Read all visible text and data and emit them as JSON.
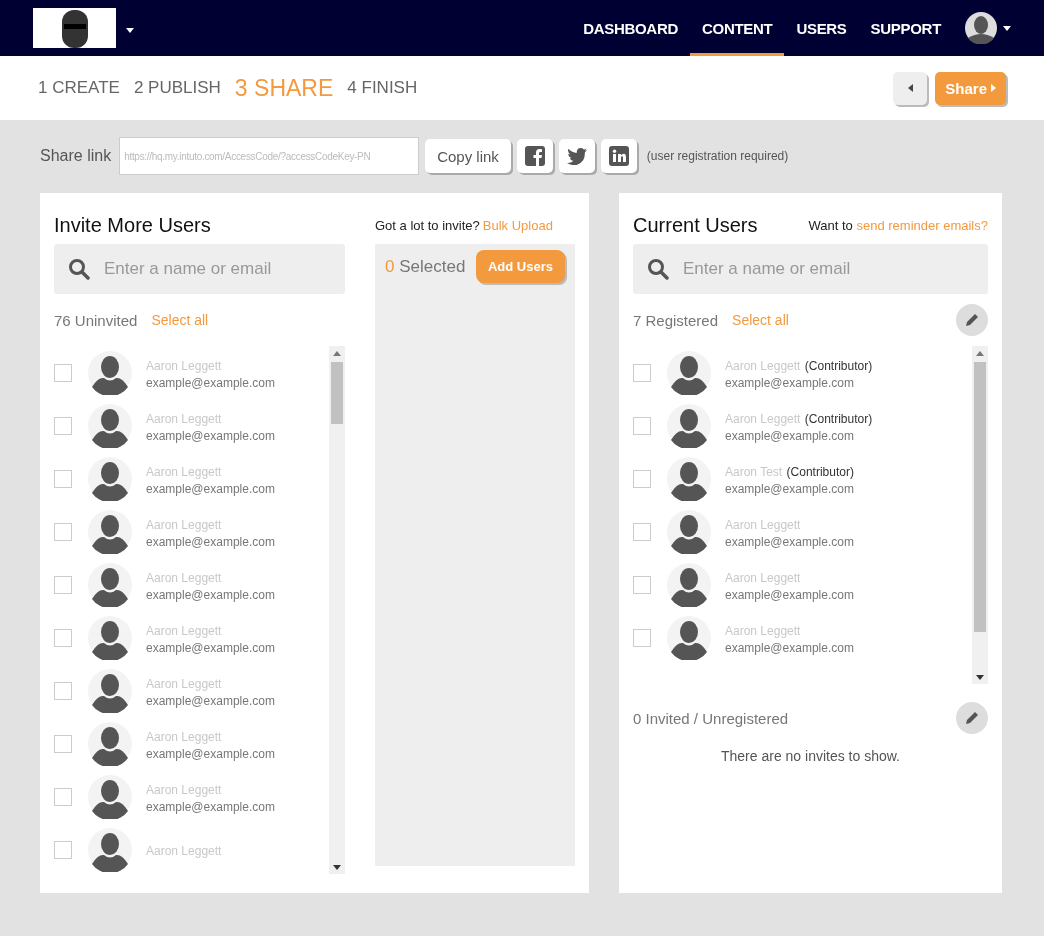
{
  "nav": {
    "items": [
      {
        "label": "DASHBOARD",
        "selected": false
      },
      {
        "label": "CONTENT",
        "selected": true
      },
      {
        "label": "USERS",
        "selected": false
      },
      {
        "label": "SUPPORT",
        "selected": false
      }
    ]
  },
  "steps": [
    {
      "number": "1",
      "label": "CREATE",
      "selected": false
    },
    {
      "number": "2",
      "label": "PUBLISH",
      "selected": false
    },
    {
      "number": "3",
      "label": "SHARE",
      "selected": true
    },
    {
      "number": "4",
      "label": "FINISH",
      "selected": false
    }
  ],
  "share_button": "Share",
  "share_link": {
    "label": "Share link",
    "value": "https://hq.my.intuto.com/AccessCode/?accessCodeKey-PN",
    "copy_button": "Copy link",
    "note": "(user registration required)"
  },
  "invite": {
    "title": "Invite More Users",
    "search": {
      "placeholder": "Enter a name or email"
    },
    "count": "76 Uninvited",
    "select_all": "Select all",
    "users": [
      {
        "name": "Aaron Leggett",
        "email": "example@example.com",
        "checked": false
      },
      {
        "name": "Aaron Leggett",
        "email": "example@example.com",
        "checked": false
      },
      {
        "name": "Aaron Leggett",
        "email": "example@example.com",
        "checked": false
      },
      {
        "name": "Aaron Leggett",
        "email": "example@example.com",
        "checked": false
      },
      {
        "name": "Aaron Leggett",
        "email": "example@example.com",
        "checked": false
      },
      {
        "name": "Aaron Leggett",
        "email": "example@example.com",
        "checked": false
      },
      {
        "name": "Aaron Leggett",
        "email": "example@example.com",
        "checked": false
      },
      {
        "name": "Aaron Leggett",
        "email": "example@example.com",
        "checked": false
      },
      {
        "name": "Aaron Leggett",
        "email": "example@example.com",
        "checked": false
      },
      {
        "name": "Aaron Leggett",
        "checked": false
      }
    ],
    "bulk_prompt": "Got a lot to invite?",
    "bulk_link": "Bulk Upload",
    "selected_count": "0",
    "selected_label": "Selected",
    "add_button": "Add Users"
  },
  "current": {
    "title": "Current Users",
    "reminder_prompt": "Want to",
    "reminder_link": "send reminder emails?",
    "search": {
      "placeholder": "Enter a name or email"
    },
    "count": "7 Registered",
    "select_all": "Select all",
    "users": [
      {
        "name": "Aaron Leggett",
        "role": "(Contributor)",
        "email": "example@example.com",
        "checked": false
      },
      {
        "name": "Aaron Leggett",
        "role": "(Contributor)",
        "email": "example@example.com",
        "checked": false
      },
      {
        "name": "Aaron Test",
        "role": "(Contributor)",
        "email": "example@example.com",
        "checked": false
      },
      {
        "name": "Aaron Leggett",
        "email": "example@example.com",
        "checked": false
      },
      {
        "name": "Aaron Leggett",
        "email": "example@example.com",
        "checked": false
      },
      {
        "name": "Aaron Leggett",
        "email": "example@example.com",
        "checked": false
      }
    ],
    "invited_count": "0 Invited / Unregistered",
    "empty_message": "There are no invites to show."
  }
}
